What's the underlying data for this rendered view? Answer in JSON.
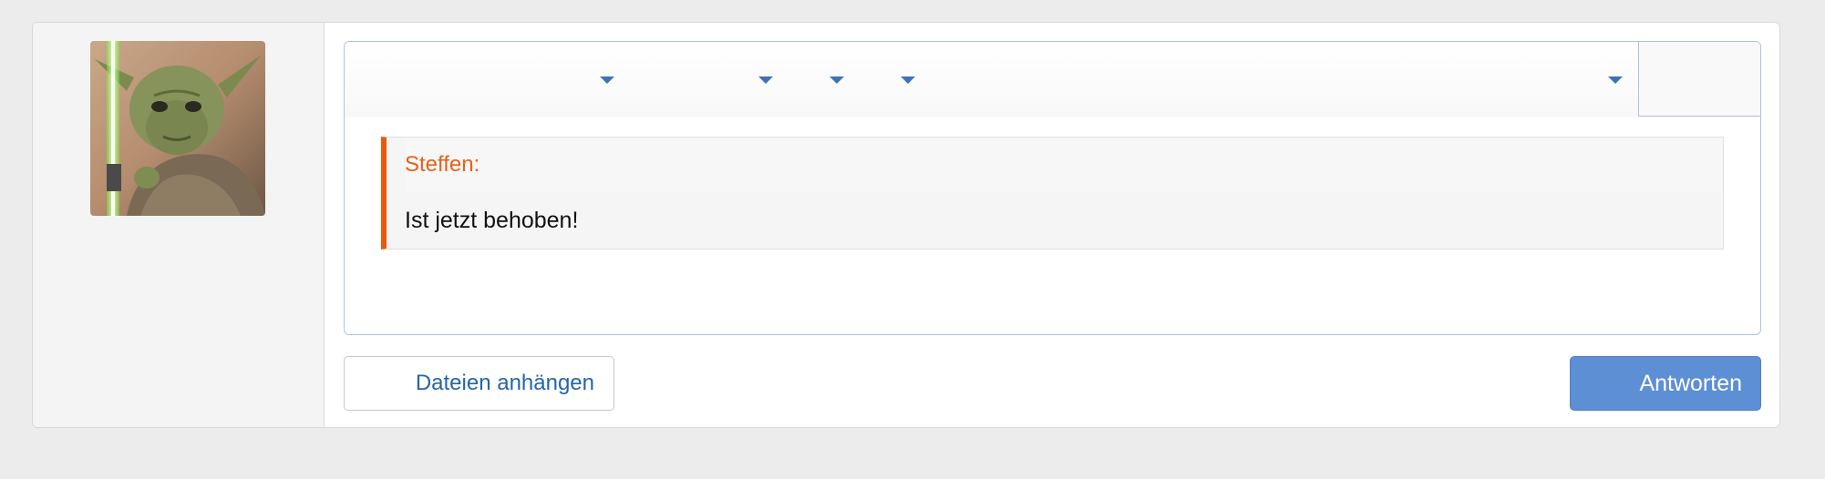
{
  "avatar": {
    "alt": "Yoda avatar"
  },
  "toolbar": {
    "dropdowns": [
      {
        "icon": "chevron-down-icon"
      },
      {
        "icon": "chevron-down-icon"
      },
      {
        "icon": "chevron-down-icon"
      },
      {
        "icon": "chevron-down-icon"
      },
      {
        "icon": "chevron-down-icon"
      }
    ]
  },
  "editor": {
    "quote": {
      "author": "Steffen:",
      "text": "Ist jetzt behoben!"
    }
  },
  "actions": {
    "attach_label": "Dateien anhängen",
    "reply_label": "Antworten"
  },
  "colors": {
    "accent_blue": "#5d8fd4",
    "link_blue": "#2565a8",
    "quote_orange": "#ea5a0c"
  }
}
